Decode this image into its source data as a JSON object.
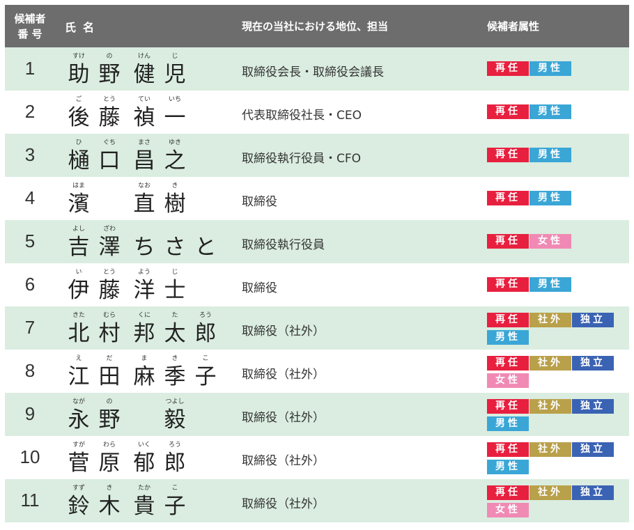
{
  "header": {
    "no_line1": "候補者",
    "no_line2": "番 号",
    "name": "氏名",
    "position": "現在の当社における地位、担当",
    "attributes": "候補者属性"
  },
  "colors": {
    "header_bg": "#6d6d6d",
    "row_shade": "#daede0",
    "badge_reappoint": "#e8203f",
    "badge_male": "#3aa6d6",
    "badge_female": "#f08ab4",
    "badge_outside": "#b9a04a",
    "badge_independent": "#3b63b3"
  },
  "rows": [
    {
      "no": "1",
      "chars": [
        {
          "k": "助",
          "r": "すけ"
        },
        {
          "k": "野",
          "r": "の"
        },
        {
          "k": "健",
          "r": "けん"
        },
        {
          "k": "児",
          "r": "じ"
        }
      ],
      "layout": [
        0,
        1,
        2,
        3
      ],
      "position": "取締役会長・取締役会議長",
      "badges": [
        {
          "text": "再任",
          "type": "reappoint"
        },
        {
          "text": "男性",
          "type": "male"
        }
      ]
    },
    {
      "no": "2",
      "chars": [
        {
          "k": "後",
          "r": "ご"
        },
        {
          "k": "藤",
          "r": "とう"
        },
        {
          "k": "禎",
          "r": "てい"
        },
        {
          "k": "一",
          "r": "いち"
        }
      ],
      "layout": [
        0,
        1,
        2,
        3
      ],
      "position": "代表取締役社長・CEO",
      "badges": [
        {
          "text": "再任",
          "type": "reappoint"
        },
        {
          "text": "男性",
          "type": "male"
        }
      ]
    },
    {
      "no": "3",
      "chars": [
        {
          "k": "樋",
          "r": "ひ"
        },
        {
          "k": "口",
          "r": "ぐち"
        },
        {
          "k": "昌",
          "r": "まさ"
        },
        {
          "k": "之",
          "r": "ゆき"
        }
      ],
      "layout": [
        0,
        1,
        2,
        3
      ],
      "position": "取締役執行役員・CFO",
      "badges": [
        {
          "text": "再任",
          "type": "reappoint"
        },
        {
          "text": "男性",
          "type": "male"
        }
      ]
    },
    {
      "no": "4",
      "chars": [
        {
          "k": "濱",
          "r": "はま"
        },
        {
          "k": "直",
          "r": "なお"
        },
        {
          "k": "樹",
          "r": "き"
        }
      ],
      "layout": [
        0,
        2,
        3
      ],
      "position": "取締役",
      "badges": [
        {
          "text": "再任",
          "type": "reappoint"
        },
        {
          "text": "男性",
          "type": "male"
        }
      ]
    },
    {
      "no": "5",
      "chars": [
        {
          "k": "吉",
          "r": "よし"
        },
        {
          "k": "澤",
          "r": "ざわ"
        },
        {
          "k": "ち",
          "r": ""
        },
        {
          "k": "さ",
          "r": ""
        },
        {
          "k": "と",
          "r": ""
        }
      ],
      "layout": [
        0,
        1,
        2,
        3,
        4
      ],
      "position": "取締役執行役員",
      "badges": [
        {
          "text": "再任",
          "type": "reappoint"
        },
        {
          "text": "女性",
          "type": "female"
        }
      ]
    },
    {
      "no": "6",
      "chars": [
        {
          "k": "伊",
          "r": "い"
        },
        {
          "k": "藤",
          "r": "とう"
        },
        {
          "k": "洋",
          "r": "よう"
        },
        {
          "k": "士",
          "r": "じ"
        }
      ],
      "layout": [
        0,
        1,
        2,
        3
      ],
      "position": "取締役",
      "badges": [
        {
          "text": "再任",
          "type": "reappoint"
        },
        {
          "text": "男性",
          "type": "male"
        }
      ]
    },
    {
      "no": "7",
      "chars": [
        {
          "k": "北",
          "r": "きた"
        },
        {
          "k": "村",
          "r": "むら"
        },
        {
          "k": "邦",
          "r": "くに"
        },
        {
          "k": "太",
          "r": "た"
        },
        {
          "k": "郎",
          "r": "ろう"
        }
      ],
      "layout": [
        0,
        1,
        2,
        3,
        4
      ],
      "position": "取締役（社外）",
      "badges": [
        {
          "text": "再任",
          "type": "reappoint"
        },
        {
          "text": "社外",
          "type": "outside"
        },
        {
          "text": "独立",
          "type": "independent"
        },
        {
          "text": "男性",
          "type": "male"
        }
      ]
    },
    {
      "no": "8",
      "chars": [
        {
          "k": "江",
          "r": "え"
        },
        {
          "k": "田",
          "r": "だ"
        },
        {
          "k": "麻",
          "r": "ま"
        },
        {
          "k": "季",
          "r": "き"
        },
        {
          "k": "子",
          "r": "こ"
        }
      ],
      "layout": [
        0,
        1,
        2,
        3,
        4
      ],
      "position": "取締役（社外）",
      "badges": [
        {
          "text": "再任",
          "type": "reappoint"
        },
        {
          "text": "社外",
          "type": "outside"
        },
        {
          "text": "独立",
          "type": "independent"
        },
        {
          "text": "女性",
          "type": "female"
        }
      ]
    },
    {
      "no": "9",
      "chars": [
        {
          "k": "永",
          "r": "なが"
        },
        {
          "k": "野",
          "r": "の"
        },
        {
          "k": "毅",
          "r": "つよし"
        }
      ],
      "layout": [
        0,
        1,
        3
      ],
      "position": "取締役（社外）",
      "badges": [
        {
          "text": "再任",
          "type": "reappoint"
        },
        {
          "text": "社外",
          "type": "outside"
        },
        {
          "text": "独立",
          "type": "independent"
        },
        {
          "text": "男性",
          "type": "male"
        }
      ]
    },
    {
      "no": "10",
      "chars": [
        {
          "k": "菅",
          "r": "すが"
        },
        {
          "k": "原",
          "r": "わら"
        },
        {
          "k": "郁",
          "r": "いく"
        },
        {
          "k": "郎",
          "r": "ろう"
        }
      ],
      "layout": [
        0,
        1,
        2,
        3
      ],
      "position": "取締役（社外）",
      "badges": [
        {
          "text": "再任",
          "type": "reappoint"
        },
        {
          "text": "社外",
          "type": "outside"
        },
        {
          "text": "独立",
          "type": "independent"
        },
        {
          "text": "男性",
          "type": "male"
        }
      ]
    },
    {
      "no": "11",
      "chars": [
        {
          "k": "鈴",
          "r": "すず"
        },
        {
          "k": "木",
          "r": "き"
        },
        {
          "k": "貴",
          "r": "たか"
        },
        {
          "k": "子",
          "r": "こ"
        }
      ],
      "layout": [
        0,
        1,
        2,
        3
      ],
      "position": "取締役（社外）",
      "badges": [
        {
          "text": "再任",
          "type": "reappoint"
        },
        {
          "text": "社外",
          "type": "outside"
        },
        {
          "text": "独立",
          "type": "independent"
        },
        {
          "text": "女性",
          "type": "female"
        }
      ]
    }
  ]
}
